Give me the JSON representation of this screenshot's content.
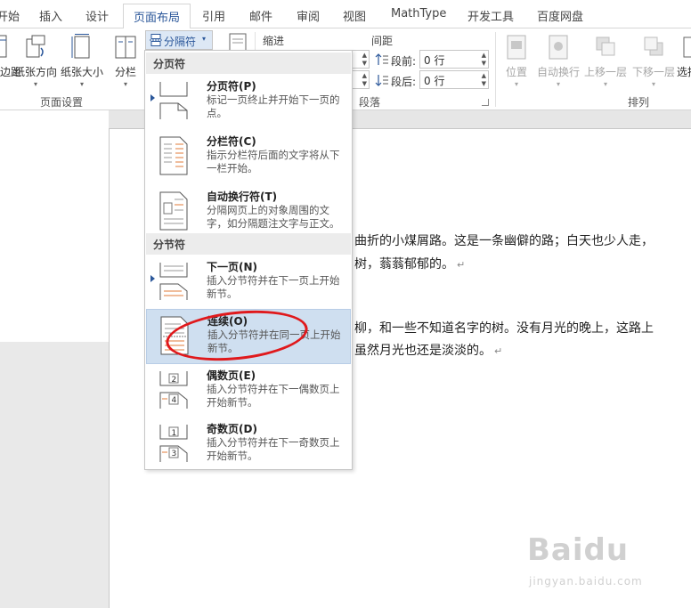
{
  "tabs": [
    "开始",
    "插入",
    "设计",
    "页面布局",
    "引用",
    "邮件",
    "审阅",
    "视图",
    "MathType",
    "开发工具",
    "百度网盘"
  ],
  "ribbon": {
    "page_setup": {
      "buttons": [
        "页边距",
        "纸张方向",
        "纸张大小",
        "分栏"
      ],
      "group_label": "页面设置"
    },
    "breaks_button": "分隔符",
    "paragraph": {
      "indent_label": "缩进",
      "spacing_label": "间距",
      "before_label": "段前:",
      "before_value": "0 行",
      "after_label": "段后:",
      "after_value": "0 行",
      "group_label": "段落"
    },
    "arrange": {
      "buttons": [
        "位置",
        "自动换行",
        "上移一层",
        "下移一层",
        "选择窗格"
      ],
      "group_label": "排列"
    }
  },
  "menu": {
    "section_page_breaks": "分页符",
    "section_section_breaks": "分节符",
    "items": [
      {
        "title": "分页符(P)",
        "desc": "标记一页终止并开始下一页的点。"
      },
      {
        "title": "分栏符(C)",
        "desc": "指示分栏符后面的文字将从下一栏开始。"
      },
      {
        "title": "自动换行符(T)",
        "desc": "分隔网页上的对象周围的文字，如分隔题注文字与正文。"
      },
      {
        "title": "下一页(N)",
        "desc": "插入分节符并在下一页上开始新节。"
      },
      {
        "title": "连续(O)",
        "desc": "插入分节符并在同一页上开始新节。"
      },
      {
        "title": "偶数页(E)",
        "desc": "插入分节符并在下一偶数页上开始新节。"
      },
      {
        "title": "奇数页(D)",
        "desc": "插入分节符并在下一奇数页上开始新节。"
      }
    ]
  },
  "document": {
    "lines": [
      "曲折的小煤屑路。这是一条幽僻的路；白天也少人走，",
      "树，蓊蓊郁郁的。",
      "柳，和一些不知道名字的树。没有月光的晚上，这路上",
      "虽然月光也还是淡淡的。"
    ],
    "pilcrow": "↵"
  },
  "watermark": {
    "brand": "Baidu",
    "site": "jingyan.baidu.com"
  },
  "colors": {
    "accent": "#2b579a",
    "highlight": "#cfdff0",
    "annotation": "#e0191c"
  }
}
